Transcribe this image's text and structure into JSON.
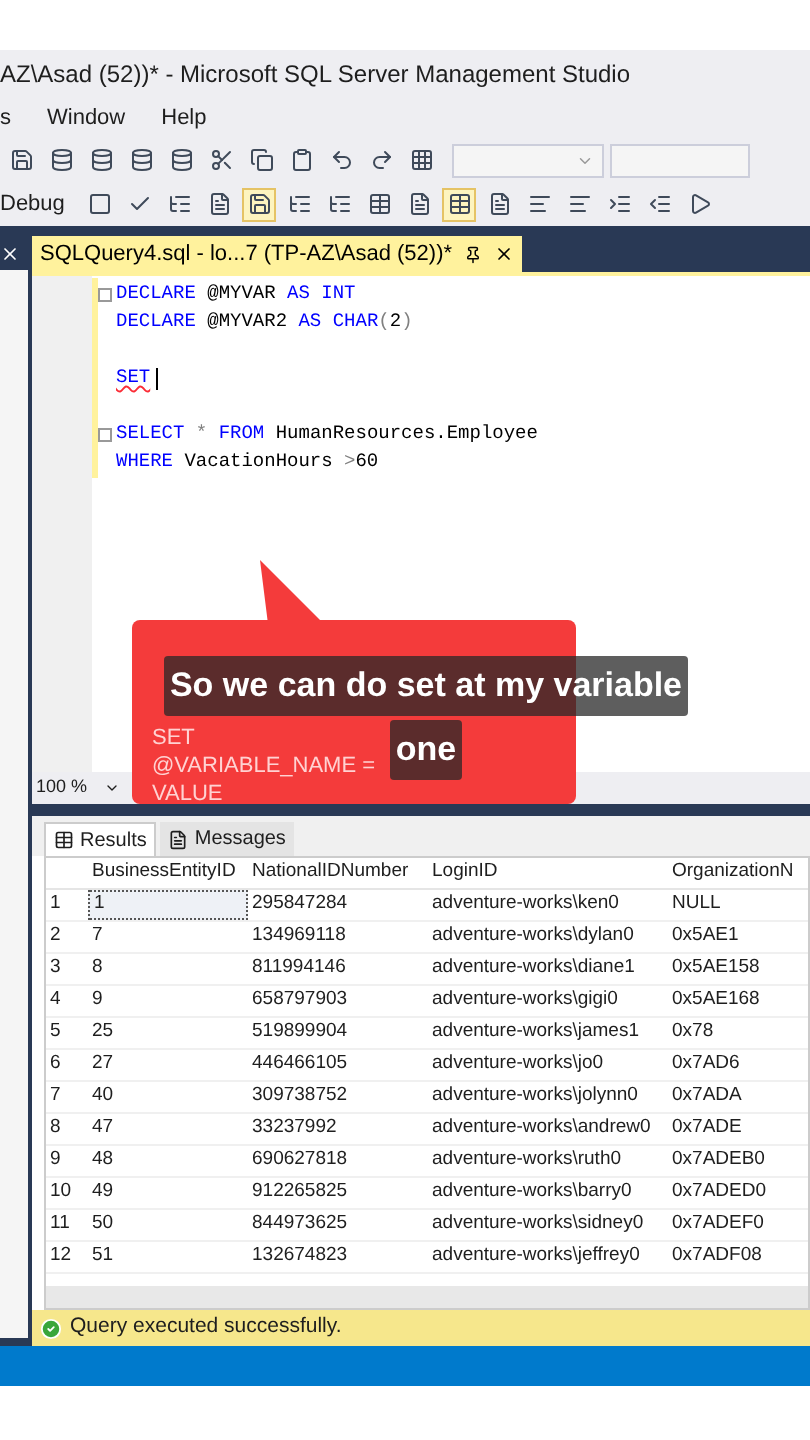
{
  "window": {
    "title": "AZ\\Asad (52))* - Microsoft SQL Server Management Studio"
  },
  "menu": [
    {
      "label": "s"
    },
    {
      "label": "Window"
    },
    {
      "label": "Help"
    }
  ],
  "toolbar": {
    "configuration": "Debug"
  },
  "editor_tab": {
    "title": "SQLQuery4.sql - lo...7 (TP-AZ\\Asad (52))*",
    "selected": true
  },
  "code_lines": [
    {
      "fold": true,
      "tokens": [
        {
          "kind": "keyword",
          "text": "DECLARE"
        },
        {
          "kind": "plain",
          "text": " @MYVAR "
        },
        {
          "kind": "keyword",
          "text": "AS INT"
        }
      ]
    },
    {
      "fold": false,
      "tokens": [
        {
          "kind": "keyword",
          "text": "DECLARE"
        },
        {
          "kind": "plain",
          "text": " @MYVAR2 "
        },
        {
          "kind": "keyword",
          "text": "AS CHAR"
        },
        {
          "kind": "operator",
          "text": "("
        },
        {
          "kind": "plain",
          "text": "2"
        },
        {
          "kind": "operator",
          "text": ")"
        }
      ]
    },
    {
      "fold": false
    },
    {
      "fold": false,
      "cursor": true,
      "tokens": [
        {
          "kind": "keyword",
          "text": "SET",
          "squiggle": true
        }
      ]
    },
    {
      "fold": false
    },
    {
      "fold": true,
      "tokens": [
        {
          "kind": "keyword",
          "text": "SELECT"
        },
        {
          "kind": "operator",
          "text": " * "
        },
        {
          "kind": "keyword",
          "text": "FROM"
        },
        {
          "kind": "plain",
          "text": " HumanResources.Employee"
        }
      ]
    },
    {
      "fold": false,
      "tokens": [
        {
          "kind": "keyword",
          "text": "WHERE"
        },
        {
          "kind": "plain",
          "text": " VacationHours "
        },
        {
          "kind": "operator",
          "text": ">"
        },
        {
          "kind": "plain",
          "text": "60"
        }
      ]
    }
  ],
  "callout": {
    "text": "SET @VARIABLE_NAME = VALUE"
  },
  "caption": {
    "lines": [
      "So we can do set at my variable",
      "one"
    ]
  },
  "zoom": {
    "value": "100 %"
  },
  "result_tabs": [
    {
      "label": "Results",
      "selected": true
    },
    {
      "label": "Messages",
      "selected": false
    }
  ],
  "table": {
    "columns": [
      "BusinessEntityID",
      "NationalIDNumber",
      "LoginID",
      "OrganizationN"
    ],
    "rows": [
      {
        "number": "1",
        "selected": true,
        "cells": [
          "1",
          "295847284",
          "adventure-works\\ken0",
          "NULL"
        ]
      },
      {
        "number": "2",
        "selected": false,
        "cells": [
          "7",
          "134969118",
          "adventure-works\\dylan0",
          "0x5AE1"
        ]
      },
      {
        "number": "3",
        "selected": false,
        "cells": [
          "8",
          "811994146",
          "adventure-works\\diane1",
          "0x5AE158"
        ]
      },
      {
        "number": "4",
        "selected": false,
        "cells": [
          "9",
          "658797903",
          "adventure-works\\gigi0",
          "0x5AE168"
        ]
      },
      {
        "number": "5",
        "selected": false,
        "cells": [
          "25",
          "519899904",
          "adventure-works\\james1",
          "0x78"
        ]
      },
      {
        "number": "6",
        "selected": false,
        "cells": [
          "27",
          "446466105",
          "adventure-works\\jo0",
          "0x7AD6"
        ]
      },
      {
        "number": "7",
        "selected": false,
        "cells": [
          "40",
          "309738752",
          "adventure-works\\jolynn0",
          "0x7ADA"
        ]
      },
      {
        "number": "8",
        "selected": false,
        "cells": [
          "47",
          "33237992",
          "adventure-works\\andrew0",
          "0x7ADE"
        ]
      },
      {
        "number": "9",
        "selected": false,
        "cells": [
          "48",
          "690627818",
          "adventure-works\\ruth0",
          "0x7ADEB0"
        ]
      },
      {
        "number": "10",
        "selected": false,
        "cells": [
          "49",
          "912265825",
          "adventure-works\\barry0",
          "0x7ADED0"
        ]
      },
      {
        "number": "11",
        "selected": false,
        "cells": [
          "50",
          "844973625",
          "adventure-works\\sidney0",
          "0x7ADEF0"
        ]
      },
      {
        "number": "12",
        "selected": false,
        "cells": [
          "51",
          "132674823",
          "adventure-works\\jeffrey0",
          "0x7ADF08"
        ]
      }
    ]
  },
  "status_bar": {
    "text": "Query executed successfully."
  }
}
